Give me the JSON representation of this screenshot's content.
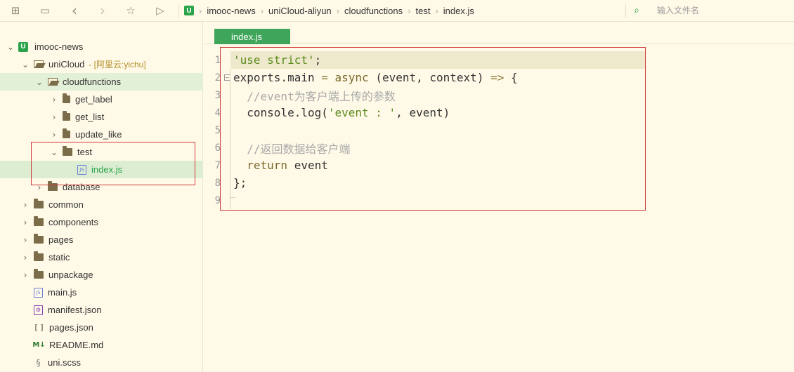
{
  "toolbar": {
    "buttons": [
      {
        "name": "new-file-icon",
        "glyph": "⊞"
      },
      {
        "name": "save-icon",
        "glyph": "▭"
      },
      {
        "name": "back-icon",
        "glyph": "‹"
      },
      {
        "name": "forward-icon",
        "glyph": "›"
      },
      {
        "name": "favorite-icon",
        "glyph": "☆"
      },
      {
        "name": "run-icon",
        "glyph": "▷"
      }
    ],
    "logo": "U"
  },
  "breadcrumb": [
    "imooc-news",
    "uniCloud-aliyun",
    "cloudfunctions",
    "test",
    "index.js"
  ],
  "search": {
    "placeholder": "输入文件名"
  },
  "tree": [
    {
      "label": "imooc-news",
      "depth": 0,
      "type": "project",
      "chevron": "⌄"
    },
    {
      "label": "uniCloud",
      "note": "- [阿里云:yichu]",
      "depth": 1,
      "type": "folder-open",
      "chevron": "⌄"
    },
    {
      "label": "cloudfunctions",
      "depth": 2,
      "type": "folder-open",
      "chevron": "⌄"
    },
    {
      "label": "get_label",
      "depth": 3,
      "type": "folder-small",
      "chevron": "›"
    },
    {
      "label": "get_list",
      "depth": 3,
      "type": "folder-small",
      "chevron": "›"
    },
    {
      "label": "update_like",
      "depth": 3,
      "type": "folder-small",
      "chevron": "›"
    },
    {
      "label": "test",
      "depth": 3,
      "type": "folder-closed",
      "chevron": "⌄"
    },
    {
      "label": "index.js",
      "depth": 4,
      "type": "js",
      "chevron": ""
    },
    {
      "label": "database",
      "depth": 2,
      "type": "folder-closed",
      "chevron": "›"
    },
    {
      "label": "common",
      "depth": 1,
      "type": "folder-closed",
      "chevron": "›"
    },
    {
      "label": "components",
      "depth": 1,
      "type": "folder-closed",
      "chevron": "›"
    },
    {
      "label": "pages",
      "depth": 1,
      "type": "folder-closed",
      "chevron": "›"
    },
    {
      "label": "static",
      "depth": 1,
      "type": "folder-closed",
      "chevron": "›"
    },
    {
      "label": "unpackage",
      "depth": 1,
      "type": "folder-closed",
      "chevron": "›"
    },
    {
      "label": "main.js",
      "depth": 1,
      "type": "js",
      "chevron": ""
    },
    {
      "label": "manifest.json",
      "depth": 1,
      "type": "json",
      "chevron": ""
    },
    {
      "label": "pages.json",
      "depth": 1,
      "type": "bracket",
      "chevron": ""
    },
    {
      "label": "README.md",
      "depth": 1,
      "type": "md",
      "chevron": ""
    },
    {
      "label": "uni.scss",
      "depth": 1,
      "type": "scss",
      "chevron": ""
    }
  ],
  "editor": {
    "tab": "index.js",
    "lines": [
      {
        "n": "1",
        "fold": "",
        "parts": [
          [
            "str",
            "'use strict'"
          ],
          [
            "",
            ";"
          ]
        ]
      },
      {
        "n": "2",
        "fold": "−",
        "parts": [
          [
            "",
            "exports.main "
          ],
          [
            "op",
            "="
          ],
          [
            "",
            " "
          ],
          [
            "kw",
            "async"
          ],
          [
            "",
            " (event, context) "
          ],
          [
            "op",
            "=>"
          ],
          [
            "",
            " {"
          ]
        ]
      },
      {
        "n": "3",
        "fold": "",
        "parts": [
          [
            "cm",
            "  //event为客户端上传的参数"
          ]
        ]
      },
      {
        "n": "4",
        "fold": "",
        "parts": [
          [
            "",
            "  console.log("
          ],
          [
            "str",
            "'event : '"
          ],
          [
            "",
            ", event)"
          ]
        ]
      },
      {
        "n": "5",
        "fold": "",
        "parts": []
      },
      {
        "n": "6",
        "fold": "",
        "parts": [
          [
            "cm",
            "  //返回数据给客户端"
          ]
        ]
      },
      {
        "n": "7",
        "fold": "",
        "parts": [
          [
            "kw",
            "  return"
          ],
          [
            "",
            " event"
          ]
        ]
      },
      {
        "n": "8",
        "fold": "",
        "parts": [
          [
            "",
            "};"
          ]
        ]
      },
      {
        "n": "9",
        "fold": "",
        "parts": []
      }
    ]
  },
  "colors": {
    "accent": "#3ea55a",
    "background": "#fffae8",
    "annotation": "#d03a3a"
  }
}
